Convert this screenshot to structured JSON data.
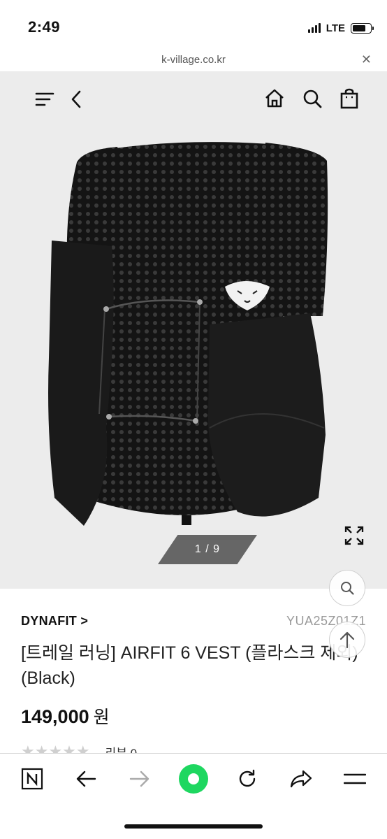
{
  "status": {
    "time": "2:49",
    "network": "LTE",
    "battery_level": 0.75
  },
  "browser": {
    "url": "k-village.co.kr",
    "close_icon": "close-icon"
  },
  "header": {
    "icons": [
      "menu-icon",
      "back-chevron-icon",
      "home-icon",
      "search-icon",
      "shopping-bag-icon"
    ]
  },
  "gallery": {
    "counter": "1 / 9",
    "expand_icon": "expand-icon"
  },
  "product": {
    "brand": "DYNAFIT >",
    "code": "YUA25Z01Z1",
    "title": "[트레일 러닝] AIRFIT 6 VEST (플라스크 제외) (Black)",
    "price": "149,000",
    "price_unit": "원",
    "rating_stars": 0,
    "review_label": "리뷰 0"
  },
  "toolbar": {
    "accent_color": "#1ed760",
    "icons": [
      "naver-n-icon",
      "back-arrow-icon",
      "forward-arrow-icon",
      "green-dot-icon",
      "refresh-icon",
      "share-icon",
      "hamburger-icon"
    ]
  }
}
